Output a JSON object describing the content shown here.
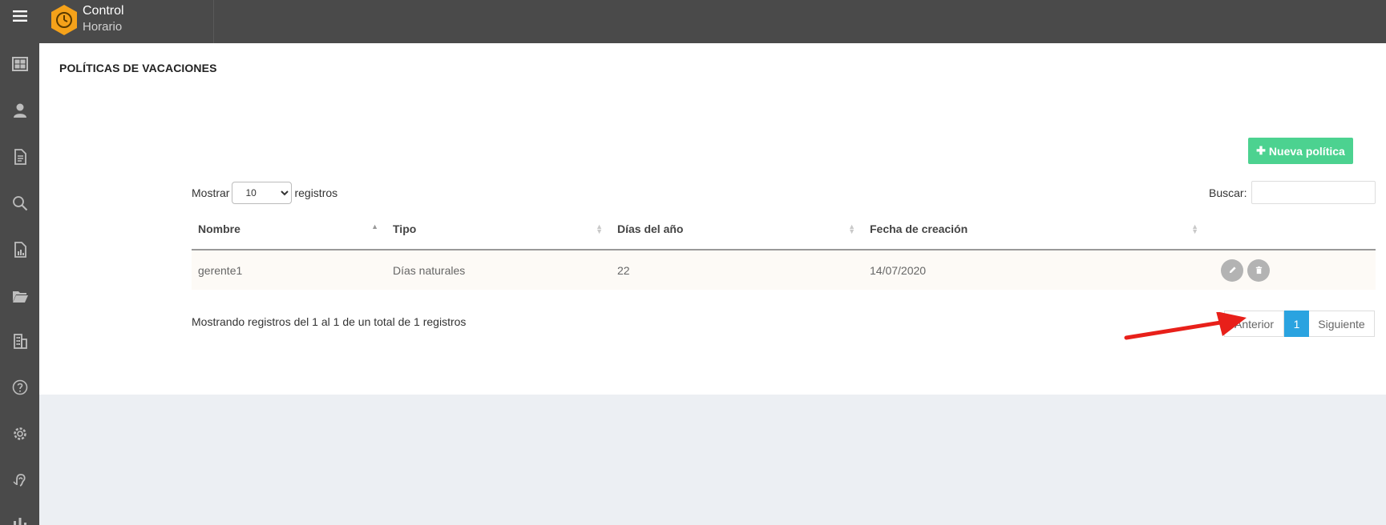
{
  "app": {
    "brand_line1": "Control",
    "brand_line2": "Horario",
    "accent_color": "#f5a21a"
  },
  "sidebar": {
    "items": [
      {
        "icon": "hamburger-menu-icon"
      },
      {
        "icon": "dashboard-icon"
      },
      {
        "icon": "user-icon"
      },
      {
        "icon": "document-icon"
      },
      {
        "icon": "search-icon"
      },
      {
        "icon": "report-icon"
      },
      {
        "icon": "folder-icon"
      },
      {
        "icon": "building-icon"
      },
      {
        "icon": "help-icon"
      },
      {
        "icon": "gear-icon"
      },
      {
        "icon": "ear-icon"
      },
      {
        "icon": "team-icon"
      }
    ]
  },
  "page": {
    "title": "POLÍTICAS DE VACACIONES",
    "new_button_label": "Nueva política",
    "new_button_color": "#4cd290"
  },
  "table_controls": {
    "show_label": "Mostrar",
    "show_value": "10",
    "records_label": "registros",
    "search_label": "Buscar:",
    "search_value": ""
  },
  "table": {
    "columns": [
      "Nombre",
      "Tipo",
      "Días del año",
      "Fecha de creación"
    ],
    "rows": [
      {
        "nombre": "gerente1",
        "tipo": "Días naturales",
        "dias": "22",
        "fecha": "14/07/2020"
      }
    ]
  },
  "footer": {
    "info": "Mostrando registros del 1 al 1 de un total de 1 registros",
    "prev_label": "Anterior",
    "current_page": "1",
    "next_label": "Siguiente",
    "page_color": "#2aa3e0"
  }
}
